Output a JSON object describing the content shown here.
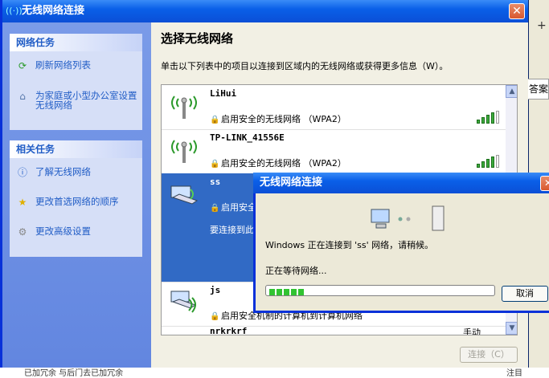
{
  "window": {
    "title": "无线网络连接",
    "close": "✕"
  },
  "sidebar": {
    "tasks": {
      "title": "网络任务",
      "items": [
        {
          "label": "刷新网络列表",
          "icon": "refresh-icon"
        },
        {
          "label": "为家庭或小型办公室设置无线网络",
          "icon": "setup-icon"
        }
      ]
    },
    "related": {
      "title": "相关任务",
      "items": [
        {
          "label": "了解无线网络",
          "icon": "info-icon"
        },
        {
          "label": "更改首选网络的顺序",
          "icon": "star-icon"
        },
        {
          "label": "更改高级设置",
          "icon": "wrench-icon"
        }
      ]
    }
  },
  "main": {
    "title": "选择无线网络",
    "description": "单击以下列表中的项目以连接到区域内的无线网络或获得更多信息（W）。",
    "networks": [
      {
        "name": "LiHui",
        "security": "启用安全的无线网络 （WPA2）",
        "signal": 4
      },
      {
        "name": "TP-LINK_41556E",
        "security": "启用安全的无线网络 （WPA2）",
        "signal": 4
      },
      {
        "name": "ss",
        "security": "启用安全",
        "extra": "要连接到此",
        "signal": 4
      },
      {
        "name": "js",
        "security": "启用安全机制的计算机到计算机网络",
        "signal": 0
      },
      {
        "name": "nrkrkrf",
        "security": "手动",
        "signal": 0
      }
    ],
    "connect_button": "连接（C）"
  },
  "dialog": {
    "title": "无线网络连接",
    "close": "✕",
    "message": "Windows 正在连接到 'ss' 网络，请稍候。",
    "status": "正在等待网络...",
    "progress": 0.2,
    "cancel": "取消"
  },
  "background": {
    "partial_text": "答案",
    "bottom_text": "已加冗余 与后门去已加冗余",
    "bottom_right": "注目"
  },
  "colors": {
    "title_blue": "#0a5fe8",
    "link_blue": "#215dc6",
    "selected": "#316ac5",
    "signal_green": "#3caa3c"
  }
}
